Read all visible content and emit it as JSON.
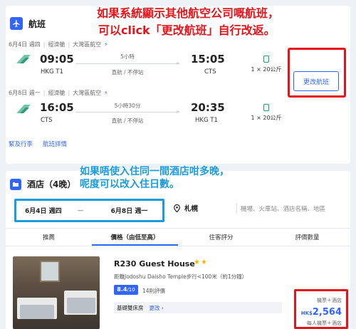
{
  "flight": {
    "title": "航班",
    "outbound": {
      "date": "6月4日 週四",
      "cabin": "經濟艙",
      "airline": "大灣區航空",
      "dep_time": "09:05",
      "dep_code": "HKG T1",
      "duration": "5小時",
      "stops": "直航 / 不停站",
      "arr_time": "15:05",
      "arr_code": "CTS",
      "baggage": "1 × 20公斤"
    },
    "inbound": {
      "date": "6月8日 週一",
      "cabin": "經濟艙",
      "airline": "大灣區航空",
      "dep_time": "16:05",
      "dep_code": "CTS",
      "duration": "5小時30分",
      "stops": "直航 / 不停站",
      "arr_time": "20:35",
      "arr_code": "HKG T1",
      "baggage": "1 × 20公斤"
    },
    "change_label": "更改航班",
    "links": [
      "緊及行李",
      "航班詳情"
    ]
  },
  "annotations": {
    "red_line1": "如果系統顯示其他航空公司嘅航班，",
    "red_line2": "可以click「更改航班」自行改返。",
    "blue_line1": "如果唔使入住同一間酒店咁多晚，",
    "blue_line2": "呢度可以改入住日數。"
  },
  "hotel": {
    "title": "酒店（4晚）",
    "checkin": "6月4日 週四",
    "dash": "—",
    "checkout": "6月8日 週一",
    "city": "札幌",
    "search_placeholder": "機場、火車站、酒店名稱、地區",
    "tabs": [
      "推薦",
      "價格（由低至高）",
      "住客評分",
      "評價數量"
    ],
    "active_tab": 1,
    "item": {
      "name": "R230 Guest House",
      "stars": "★★",
      "location": "距離Jodoshu Daisho Temple步行<100米（約1分鐘）",
      "score": "8.4",
      "score_max": "/10",
      "reviews": "14則評價",
      "room": "基礎雙床房",
      "room_change": "更改",
      "price_label": "機票＋酒店",
      "price_currency": "HK$",
      "price_value": "2,564",
      "price_sub": "每人機票＋酒店"
    }
  },
  "colors": {
    "accent": "#3264ff",
    "annotation_red": "#e6141a",
    "annotation_blue": "#1a9bde",
    "baggage_green": "#1aa260",
    "star": "#f5b700"
  }
}
